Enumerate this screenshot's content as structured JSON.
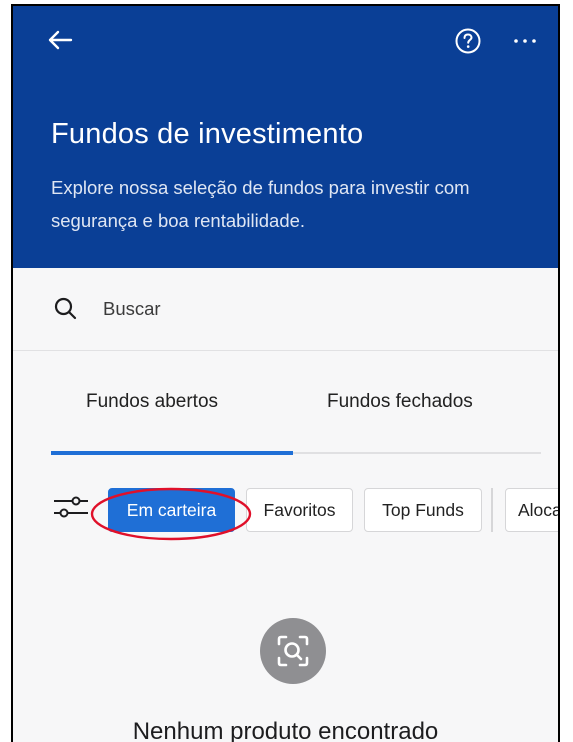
{
  "header": {
    "title": "Fundos de investimento",
    "subtitle": "Explore nossa seleção de fundos para investir com segurança e boa rentabilidade.",
    "back_icon": "arrow-left-icon",
    "help_icon": "question-circle-icon",
    "more_icon": "ellipsis-icon",
    "background_color": "#0a3f96"
  },
  "search": {
    "placeholder": "Buscar",
    "icon": "search-icon"
  },
  "tabs": [
    {
      "label": "Fundos abertos",
      "active": true
    },
    {
      "label": "Fundos fechados",
      "active": false
    }
  ],
  "filters": {
    "icon": "sliders-icon",
    "chips": [
      {
        "label": "Em carteira",
        "active": true
      },
      {
        "label": "Favoritos",
        "active": false
      },
      {
        "label": "Top Funds",
        "active": false
      },
      {
        "label": "Alocação",
        "active": false
      }
    ],
    "active_color": "#1f6fd6"
  },
  "annotation": {
    "color": "#e0102a"
  },
  "empty_state": {
    "icon": "search-scan-icon",
    "message": "Nenhum produto encontrado"
  }
}
